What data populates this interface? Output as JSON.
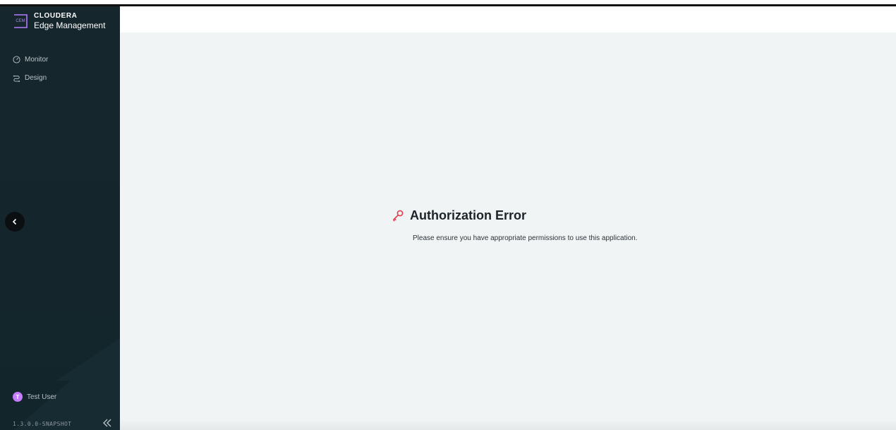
{
  "brand": {
    "badge": "CEM",
    "name_top": "CLOUDERA",
    "name_bottom": "Edge Management",
    "accent": "#b57cff"
  },
  "sidebar": {
    "items": [
      {
        "label": "Monitor",
        "icon": "gauge-icon"
      },
      {
        "label": "Design",
        "icon": "design-icon"
      }
    ],
    "user": {
      "initial": "T",
      "name": "Test User"
    },
    "version": "1.3.0.0-SNAPSHOT",
    "colors": {
      "bg": "#16262d",
      "text": "#b9c3c7"
    }
  },
  "error": {
    "title": "Authorization Error",
    "message": "Please ensure you have appropriate permissions to use this application.",
    "icon": "key-icon",
    "icon_color": "#e53b50"
  }
}
